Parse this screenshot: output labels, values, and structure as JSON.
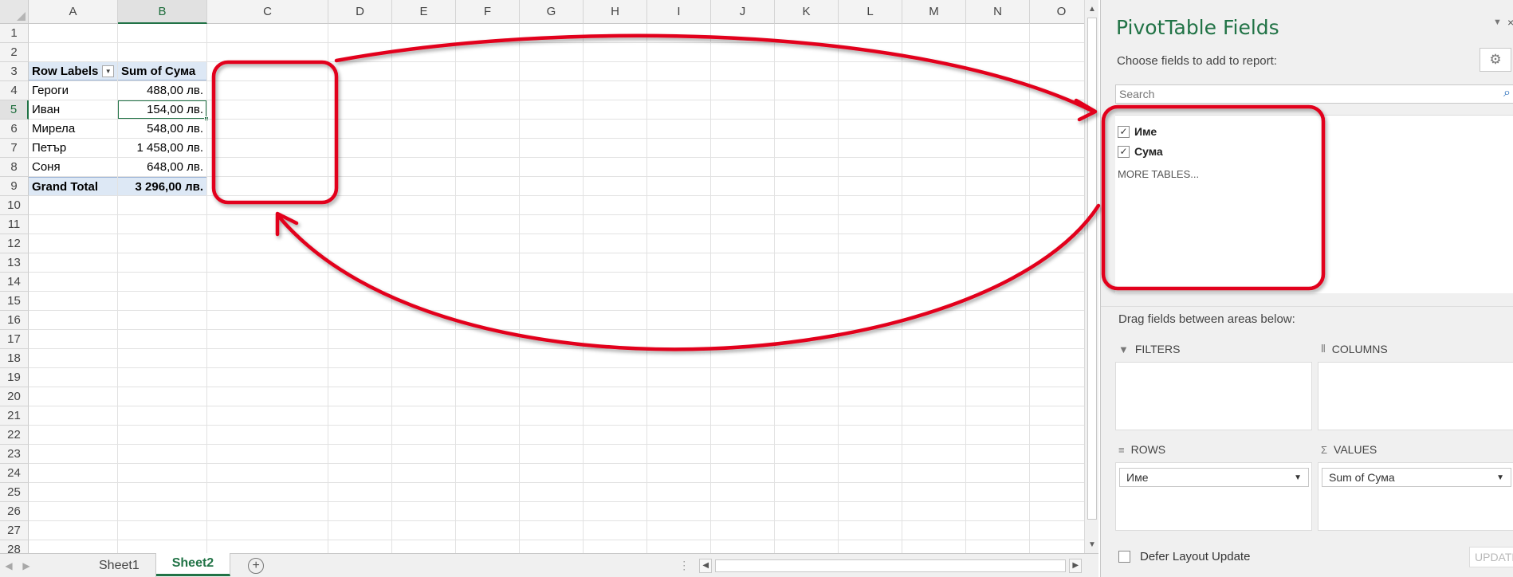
{
  "spreadsheet": {
    "columns": [
      "A",
      "B",
      "C",
      "D",
      "E",
      "F",
      "G",
      "H",
      "I",
      "J",
      "K",
      "L",
      "M",
      "N",
      "O"
    ],
    "rows": [
      "1",
      "2",
      "3",
      "4",
      "5",
      "6",
      "7",
      "8",
      "9",
      "10",
      "11",
      "12",
      "13",
      "14",
      "15",
      "16",
      "17",
      "18",
      "19",
      "20",
      "21",
      "22",
      "23",
      "24",
      "25",
      "26",
      "27",
      "28"
    ],
    "selected_column": "B",
    "selected_row": "5",
    "pivot": {
      "header_row_label": "Row Labels",
      "header_value_label": "Sum of Сума",
      "rows": [
        {
          "name": "Героги",
          "value": "488,00 лв."
        },
        {
          "name": "Иван",
          "value": "154,00 лв."
        },
        {
          "name": "Мирела",
          "value": "548,00 лв."
        },
        {
          "name": "Петър",
          "value": "1 458,00 лв."
        },
        {
          "name": "Соня",
          "value": "648,00 лв."
        }
      ],
      "total_label": "Grand Total",
      "total_value": "3 296,00 лв."
    }
  },
  "sheet_tabs": [
    "Sheet1",
    "Sheet2"
  ],
  "active_sheet": "Sheet2",
  "pivot_pane": {
    "title": "PivotTable Fields",
    "subtitle": "Choose fields to add to report:",
    "search_placeholder": "Search",
    "fields": [
      {
        "label": "Име",
        "checked": true
      },
      {
        "label": "Сума",
        "checked": true
      }
    ],
    "more_tables": "MORE TABLES...",
    "drag_label": "Drag fields between areas below:",
    "areas": {
      "filters": {
        "label": "FILTERS",
        "icon": "filter-icon"
      },
      "columns": {
        "label": "COLUMNS",
        "icon": "columns-icon"
      },
      "rows": {
        "label": "ROWS",
        "icon": "rows-icon",
        "item": "Име"
      },
      "values": {
        "label": "VALUES",
        "icon": "sigma-icon",
        "item": "Sum of Сума"
      }
    },
    "defer_label": "Defer Layout Update",
    "update_label": "UPDATE"
  },
  "annotation_color": "#e2001a"
}
